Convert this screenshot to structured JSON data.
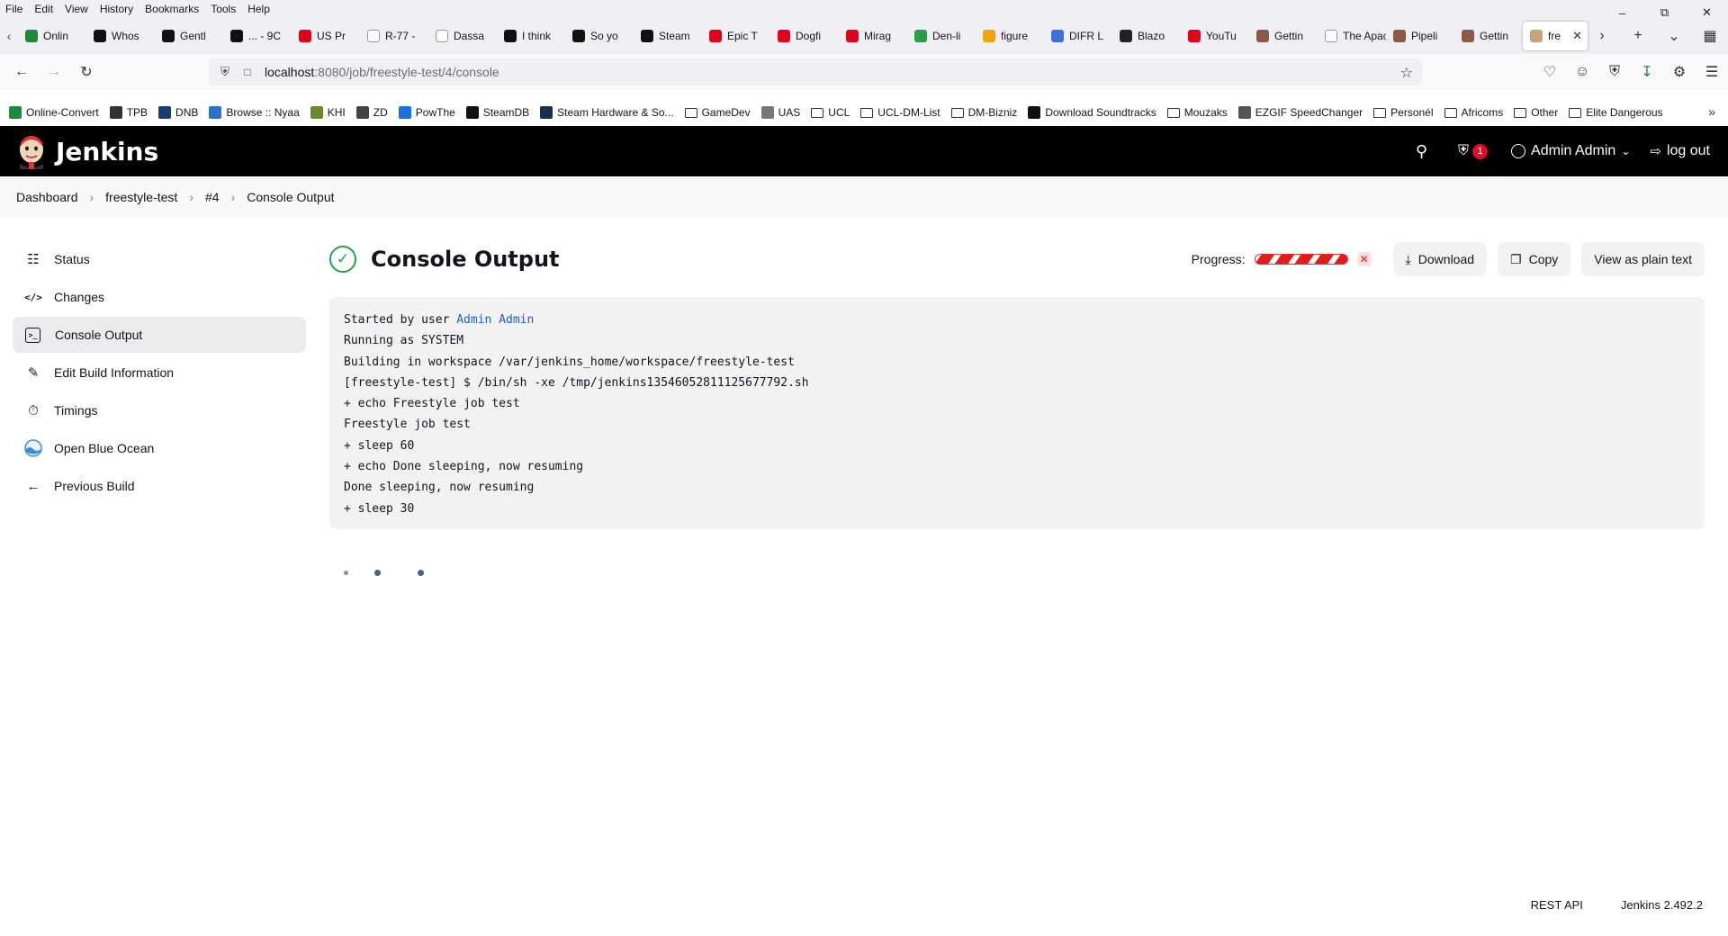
{
  "browser": {
    "menu": [
      "File",
      "Edit",
      "View",
      "History",
      "Bookmarks",
      "Tools",
      "Help"
    ],
    "tabs": [
      {
        "label": "Onlin",
        "color": "#1b8a3a"
      },
      {
        "label": "Whos",
        "color": "#111111"
      },
      {
        "label": "Gentl",
        "color": "#111111"
      },
      {
        "label": "... - 9C",
        "color": "#111111"
      },
      {
        "label": "US Pr",
        "color": "#e3001b"
      },
      {
        "label": "R-77 -",
        "color": "#ffffff"
      },
      {
        "label": "Dassa",
        "color": "#ffffff"
      },
      {
        "label": "I think",
        "color": "#111111"
      },
      {
        "label": "So yo",
        "color": "#111111"
      },
      {
        "label": "Steam",
        "color": "#111111"
      },
      {
        "label": "Epic T",
        "color": "#e3001b"
      },
      {
        "label": "Dogfi",
        "color": "#e3001b"
      },
      {
        "label": "Mirag",
        "color": "#e3001b"
      },
      {
        "label": "Den-li",
        "color": "#2a9d4a"
      },
      {
        "label": "figure",
        "color": "#f2a20c"
      },
      {
        "label": "DIFR L",
        "color": "#3c73d9"
      },
      {
        "label": "Blazo",
        "color": "#222222"
      },
      {
        "label": "YouTu",
        "color": "#e3001b"
      },
      {
        "label": "Gettin",
        "color": "#8a5a44"
      },
      {
        "label": "The Apach",
        "color": "#ffffff"
      },
      {
        "label": "Pipeli",
        "color": "#8a5a44"
      },
      {
        "label": "Gettin",
        "color": "#8a5a44"
      }
    ],
    "active_tab": {
      "label": "fre",
      "color": "#c9a27a"
    },
    "url": {
      "host": "localhost",
      "rest": ":8080/job/freestyle-test/4/console"
    },
    "bookmarks": [
      {
        "label": "Online-Convert",
        "type": "site",
        "color": "#1b8a3a"
      },
      {
        "label": "TPB",
        "type": "site",
        "color": "#333333"
      },
      {
        "label": "DNB",
        "type": "site",
        "color": "#1a3e6f"
      },
      {
        "label": "Browse :: Nyaa",
        "type": "site",
        "color": "#2f6fcf"
      },
      {
        "label": "KHI",
        "type": "site",
        "color": "#6a8a2a"
      },
      {
        "label": "ZD",
        "type": "site",
        "color": "#444444"
      },
      {
        "label": "PowThe",
        "type": "site",
        "color": "#1b6fe0"
      },
      {
        "label": "SteamDB",
        "type": "site",
        "color": "#111111"
      },
      {
        "label": "Steam Hardware & So...",
        "type": "site",
        "color": "#16304f"
      },
      {
        "label": "GameDev",
        "type": "folder"
      },
      {
        "label": "UAS",
        "type": "site",
        "color": "#777777"
      },
      {
        "label": "UCL",
        "type": "folder"
      },
      {
        "label": "UCL-DM-List",
        "type": "folder"
      },
      {
        "label": "DM-Bizniz",
        "type": "folder"
      },
      {
        "label": "Download Soundtracks",
        "type": "site",
        "color": "#111111"
      },
      {
        "label": "Mouzaks",
        "type": "folder"
      },
      {
        "label": "EZGIF SpeedChanger",
        "type": "site",
        "color": "#555555"
      },
      {
        "label": "Personél",
        "type": "folder"
      },
      {
        "label": "Africoms",
        "type": "folder"
      },
      {
        "label": "Other",
        "type": "folder"
      },
      {
        "label": "Elite Dangerous",
        "type": "folder"
      }
    ]
  },
  "jenkins": {
    "title": "Jenkins",
    "security_count": "1",
    "user": "Admin Admin",
    "logout": "log out",
    "breadcrumb": [
      "Dashboard",
      "freestyle-test",
      "#4",
      "Console Output"
    ],
    "sidebar": [
      {
        "label": "Status",
        "icon": "document-icon"
      },
      {
        "label": "Changes",
        "icon": "code-icon"
      },
      {
        "label": "Console Output",
        "icon": "terminal-icon",
        "active": true
      },
      {
        "label": "Edit Build Information",
        "icon": "edit-icon"
      },
      {
        "label": "Timings",
        "icon": "stopwatch-icon"
      },
      {
        "label": "Open Blue Ocean",
        "icon": "blue-ocean-icon"
      },
      {
        "label": "Previous Build",
        "icon": "arrow-left-icon"
      }
    ],
    "page_title": "Console Output",
    "progress_label": "Progress:",
    "buttons": {
      "download": "Download",
      "copy": "Copy",
      "plain": "View as plain text"
    },
    "console": {
      "started_prefix": "Started by user ",
      "started_user": "Admin Admin",
      "lines": [
        "Running as SYSTEM",
        "Building in workspace /var/jenkins_home/workspace/freestyle-test",
        "[freestyle-test] $ /bin/sh -xe /tmp/jenkins13546052811125677792.sh",
        "+ echo Freestyle job test",
        "Freestyle job test",
        "+ sleep 60",
        "+ echo Done sleeping, now resuming",
        "Done sleeping, now resuming",
        "+ sleep 30"
      ]
    },
    "footer": {
      "rest_api": "REST API",
      "version": "Jenkins 2.492.2"
    }
  },
  "colors": {
    "success": "#1ea64b",
    "link": "#2160c4",
    "header_bg": "#000000",
    "badge": "#e00b2b",
    "progress": "#e21b1b"
  }
}
